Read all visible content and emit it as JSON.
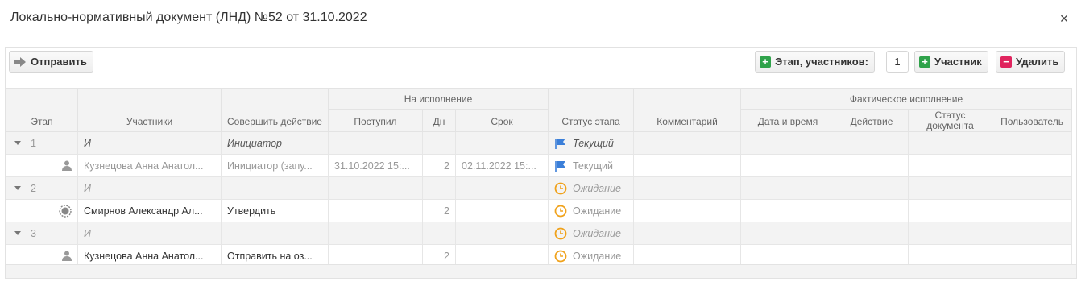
{
  "window": {
    "title": "Локально-нормативный документ (ЛНД) №52 от 31.10.2022",
    "close_label": "×"
  },
  "toolbar": {
    "send_label": "Отправить",
    "stage_label": "Этап, участников:",
    "stage_count": "1",
    "participant_label": "Участник",
    "delete_label": "Удалить"
  },
  "columns": {
    "stage": "Этап",
    "participants": "Участники",
    "action": "Совершить действие",
    "execution_group": "На исполнение",
    "received": "Поступил",
    "days": "Дн",
    "deadline": "Срок",
    "stage_status": "Статус этапа",
    "comment": "Комментарий",
    "actual_group": "Фактическое исполнение",
    "datetime": "Дата и время",
    "action_done": "Действие",
    "doc_status": "Статус документа",
    "user": "Пользователь"
  },
  "rows": [
    {
      "type": "stage",
      "num": "1",
      "participant": "И",
      "action": "Инициатор",
      "received": "",
      "days": "",
      "deadline": "",
      "status": "Текущий",
      "status_icon": "flag-icon"
    },
    {
      "type": "participant",
      "participant": "Кузнецова Анна Анатол...",
      "action": "Инициатор (запу...",
      "received": "31.10.2022 15:...",
      "days": "2",
      "deadline": "02.11.2022 15:...",
      "status": "Текущий",
      "status_icon": "flag-icon",
      "avatar": "user-icon"
    },
    {
      "type": "stage",
      "num": "2",
      "participant": "И",
      "action": "",
      "received": "",
      "days": "",
      "deadline": "",
      "status": "Ожидание",
      "status_icon": "clock-icon"
    },
    {
      "type": "participant",
      "participant": "Смирнов Александр Ал...",
      "action": "Утвердить",
      "received": "",
      "days": "2",
      "deadline": "",
      "status": "Ожидание",
      "status_icon": "clock-icon",
      "avatar": "gear-icon"
    },
    {
      "type": "stage",
      "num": "3",
      "participant": "И",
      "action": "",
      "received": "",
      "days": "",
      "deadline": "",
      "status": "Ожидание",
      "status_icon": "clock-icon"
    },
    {
      "type": "participant",
      "participant": "Кузнецова Анна Анатол...",
      "action": "Отправить на оз...",
      "received": "",
      "days": "2",
      "deadline": "",
      "status": "Ожидание",
      "status_icon": "clock-icon",
      "avatar": "user-icon"
    }
  ],
  "colors": {
    "accent_green": "#2fa24a",
    "accent_red": "#e0245e",
    "flag_blue": "#3b7fd9",
    "clock_orange": "#f0a21b"
  }
}
